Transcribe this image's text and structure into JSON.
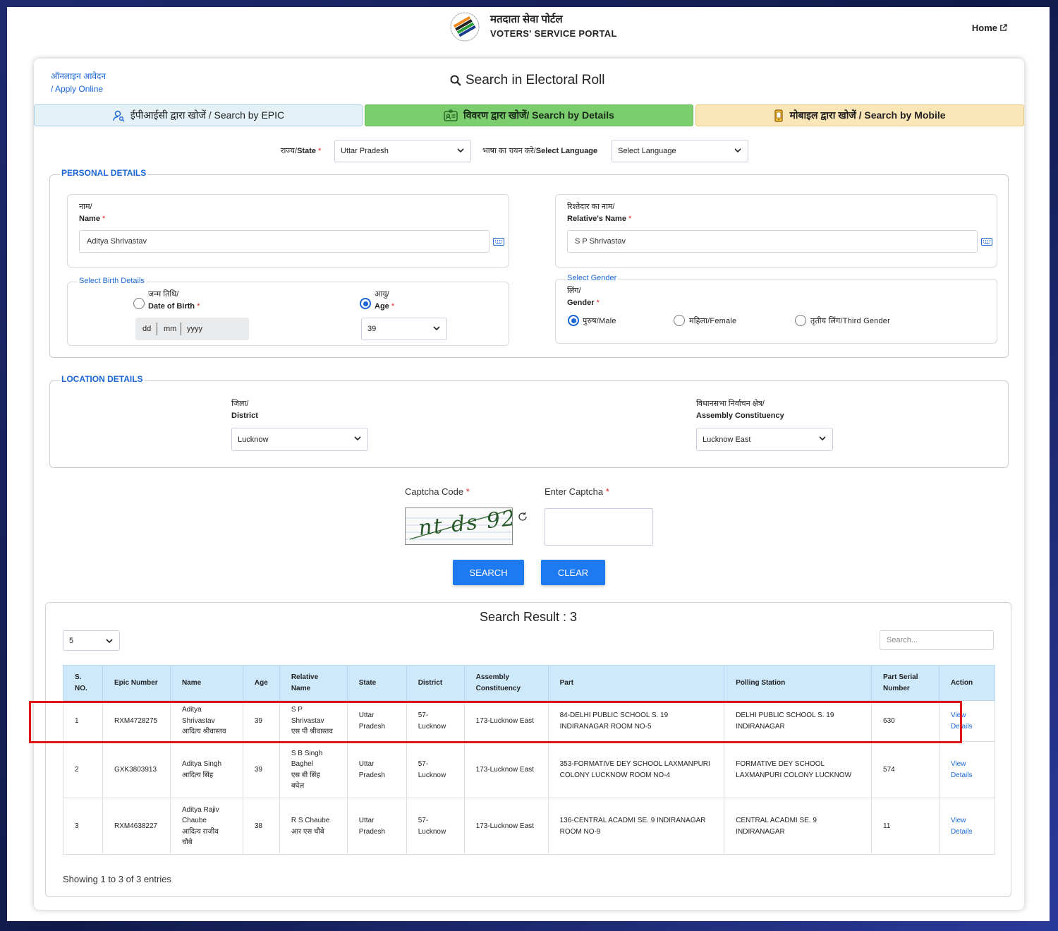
{
  "header": {
    "title_hindi": "मतदाता सेवा पोर्टल",
    "title_english": "VOTERS' SERVICE PORTAL",
    "home_label": "Home"
  },
  "card": {
    "apply_online_hindi": "ऑनलाइन आवेदन",
    "apply_online_english": "/ Apply Online",
    "title": "Search in Electoral Roll"
  },
  "tabs": [
    {
      "label": "ईपीआईसी द्वारा खोजें / Search by EPIC"
    },
    {
      "label": "विवरण द्वारा खोजें/ Search by Details"
    },
    {
      "label": "मोबाइल द्वारा खोजें / Search by Mobile"
    }
  ],
  "state": {
    "label_hi": "राज्य/",
    "label_en": "State",
    "value": "Uttar Pradesh",
    "language_label_hi": "भाषा का चयन करे/",
    "language_label_en": "Select Language",
    "language_value": "Select Language"
  },
  "personal": {
    "legend": "PERSONAL DETAILS",
    "name_label_hi": "नाम/",
    "name_label_en": "Name",
    "name_value": "Aditya Shrivastav",
    "relative_label_hi": "रिश्तेदार का नाम/",
    "relative_label_en": "Relative's Name",
    "relative_value": "S P Shrivastav",
    "birth_legend": "Select Birth Details",
    "dob_label_hi": "जन्म तिथि/",
    "dob_label_en": "Date of Birth",
    "dob_dd": "dd",
    "dob_mm": "mm",
    "dob_yyyy": "yyyy",
    "age_label_hi": "आयु/",
    "age_label_en": "Age",
    "age_value": "39",
    "gender_legend": "Select Gender",
    "gender_label_hi": "लिंग/",
    "gender_label_en": "Gender",
    "gender_male": "पुरुष/Male",
    "gender_female": "महिला/Female",
    "gender_third": "तृतीय लिंग/Third Gender"
  },
  "location": {
    "legend": "LOCATION DETAILS",
    "district_label_hi": "जिला/",
    "district_label_en": "District",
    "district_value": "Lucknow",
    "ac_label_hi": "विधानसभा निर्वाचन क्षेत्र/",
    "ac_label_en": "Assembly Constituency",
    "ac_value": "Lucknow East"
  },
  "captcha": {
    "code_label": "Captcha Code",
    "enter_label": "Enter Captcha",
    "code_text": "nt ds 92",
    "search_label": "SEARCH",
    "clear_label": "CLEAR"
  },
  "results": {
    "title": "Search Result : 3",
    "page_size": "5",
    "search_placeholder": "Search...",
    "showing": "Showing 1 to 3 of 3 entries",
    "columns": [
      "S.\nNO.",
      "Epic Number",
      "Name",
      "Age",
      "Relative\nName",
      "State",
      "District",
      "Assembly\nConstituency",
      "Part",
      "Polling Station",
      "Part Serial\nNumber",
      "Action"
    ],
    "rows": [
      {
        "sno": "1",
        "epic": "RXM4728275",
        "name": "Aditya\nShrivastav\nआदित्य श्रीवास्तव",
        "age": "39",
        "relative": "S P\nShrivastav\nएस पी श्रीवास्तव",
        "state": "Uttar\nPradesh",
        "district": "57-\nLucknow",
        "ac": "173-Lucknow East",
        "part": "84-DELHI PUBLIC SCHOOL S. 19\nINDIRANAGAR ROOM NO-5",
        "polling": "DELHI PUBLIC SCHOOL S. 19\nINDIRANAGAR",
        "serial": "630",
        "action": "View\nDetails"
      },
      {
        "sno": "2",
        "epic": "GXK3803913",
        "name": "Aditya Singh\nआदित्य सिंह",
        "age": "39",
        "relative": "S B Singh\nBaghel\nएस बी सिंह\nबघेल",
        "state": "Uttar\nPradesh",
        "district": "57-\nLucknow",
        "ac": "173-Lucknow East",
        "part": "353-FORMATIVE DEY SCHOOL LAXMANPURI\nCOLONY LUCKNOW ROOM NO-4",
        "polling": "FORMATIVE DEY SCHOOL\nLAXMANPURI COLONY LUCKNOW",
        "serial": "574",
        "action": "View\nDetails"
      },
      {
        "sno": "3",
        "epic": "RXM4638227",
        "name": "Aditya Rajiv\nChaube\nआदित्य राजीव\nचौबे",
        "age": "38",
        "relative": "R S Chaube\nआर एस चौबे",
        "state": "Uttar\nPradesh",
        "district": "57-\nLucknow",
        "ac": "173-Lucknow East",
        "part": "136-CENTRAL ACADMI SE. 9 INDIRANAGAR\nROOM NO-9",
        "polling": "CENTRAL ACADMI SE. 9\nINDIRANAGAR",
        "serial": "11",
        "action": "View\nDetails"
      }
    ]
  },
  "colors": {
    "accent_blue": "#1a66d6",
    "button_blue": "#1e7af0",
    "tab_details_green": "#7ccd6e",
    "tab_mobile_yellow": "#fbe6b8",
    "tab_epic_blue": "#e4f2f8",
    "table_header": "#cde9fb",
    "highlight_red": "#e01616"
  },
  "icons": [
    "eci-logo-icon",
    "external-link-icon",
    "search-icon",
    "user-search-icon",
    "id-card-icon",
    "mobile-icon",
    "chevron-down-icon",
    "keyboard-icon",
    "refresh-icon"
  ]
}
